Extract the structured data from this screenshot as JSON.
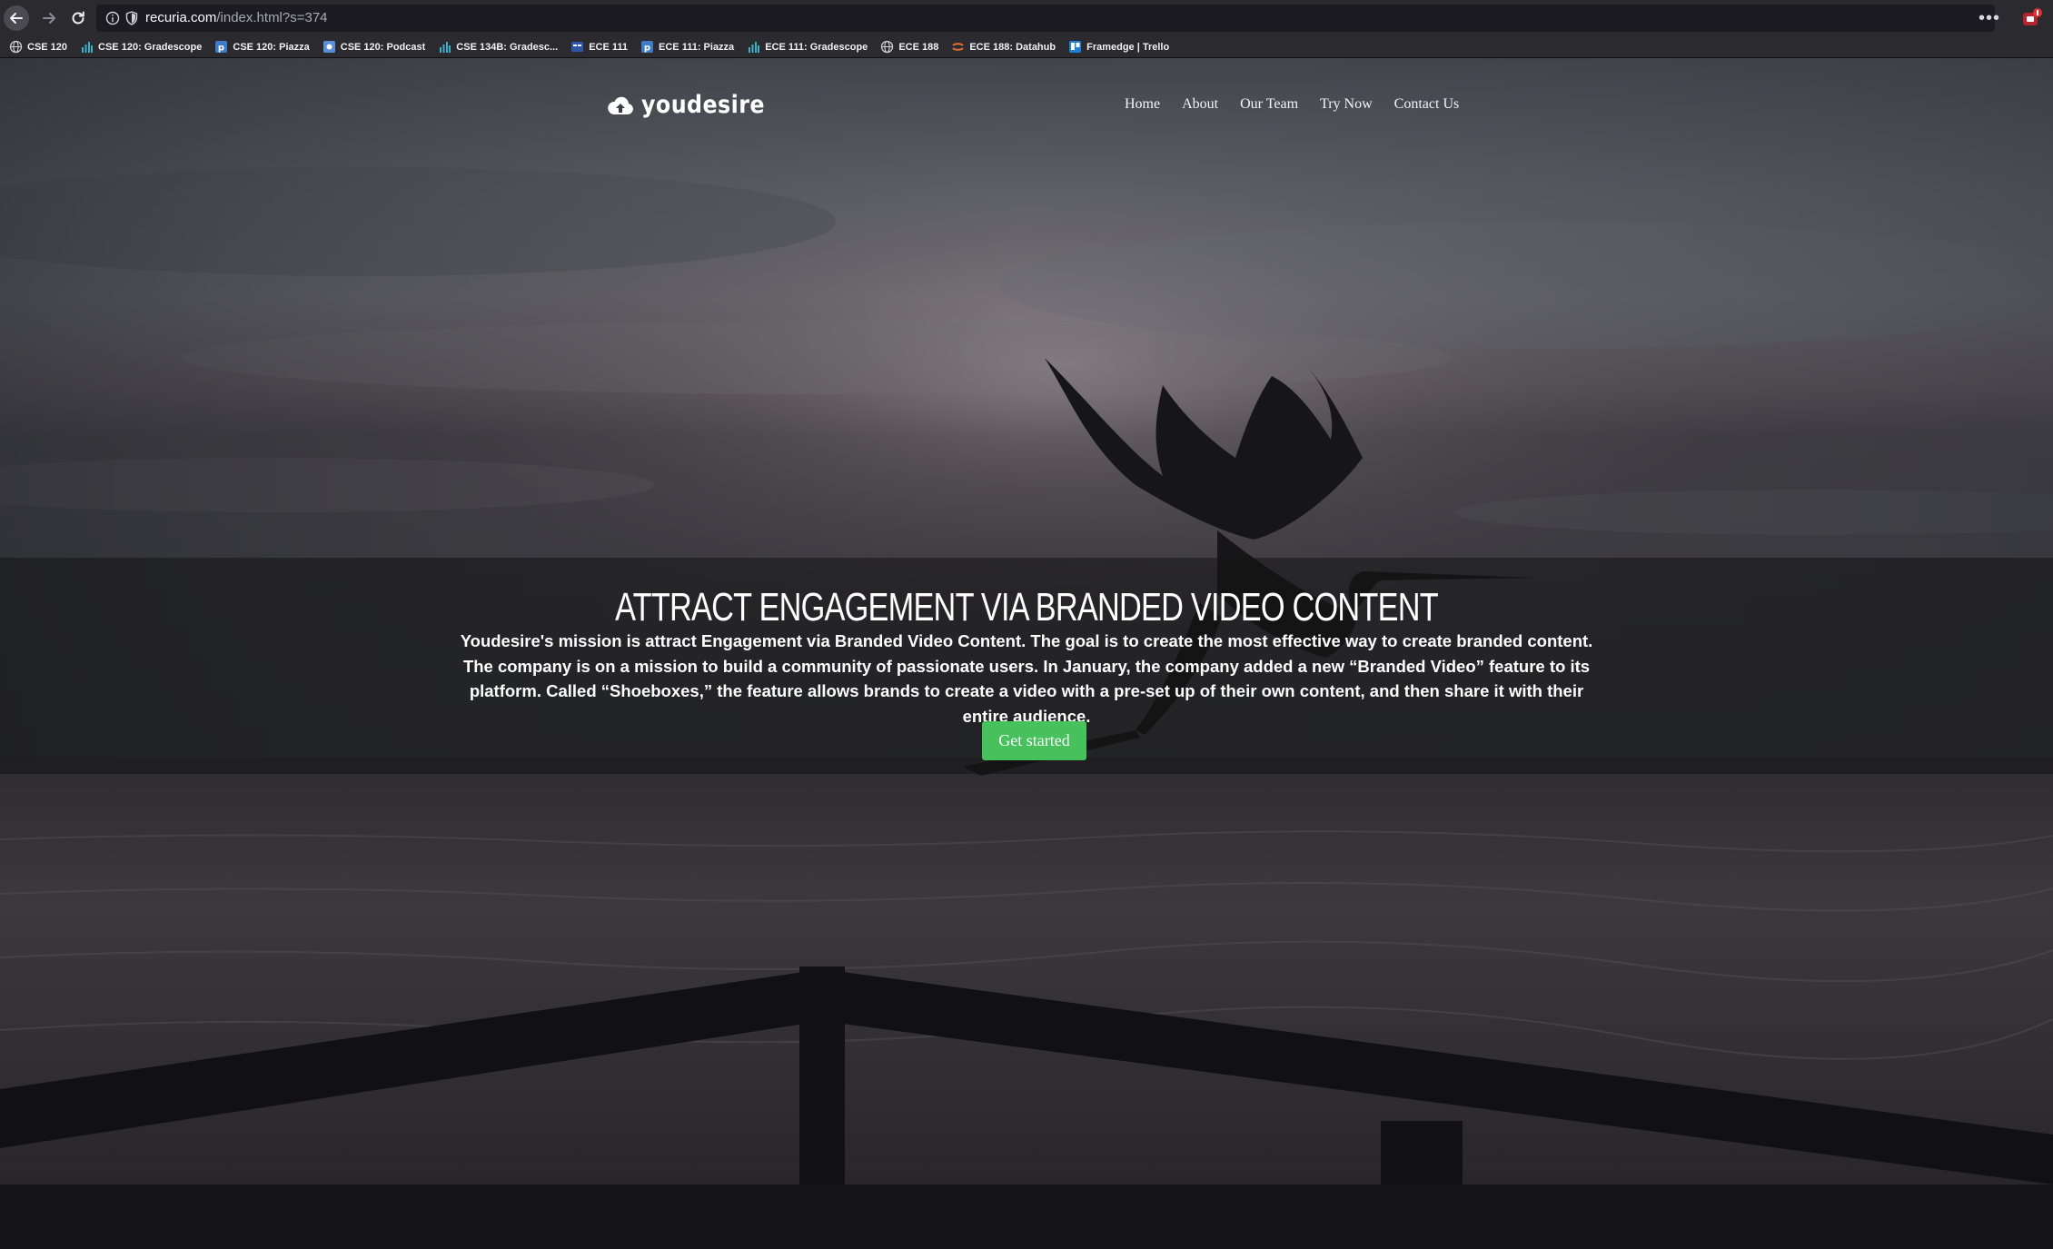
{
  "browser": {
    "url_host": "recuria.com",
    "url_path": "/index.html?s=374",
    "menu_glyph": "•••",
    "icons": {
      "back": "back-arrow-icon",
      "forward": "forward-arrow-icon",
      "reload": "reload-icon",
      "info": "info-icon",
      "shield": "shield-icon",
      "menu": "more-menu-icon",
      "extension": "extension-icon"
    },
    "bookmarks": [
      {
        "label": "CSE 120",
        "icon": "globe",
        "color": "#cfcfd4"
      },
      {
        "label": "CSE 120: Gradescope",
        "icon": "bars",
        "color": "#3bb0c9"
      },
      {
        "label": "CSE 120: Piazza",
        "icon": "piazza",
        "color": "#3e7cc7"
      },
      {
        "label": "CSE 120: Podcast",
        "icon": "podcast",
        "color": "#5a8fd8"
      },
      {
        "label": "CSE 134B: Gradesc...",
        "icon": "bars",
        "color": "#3bb0c9"
      },
      {
        "label": "ECE 111",
        "icon": "tile",
        "color": "#2f56a8"
      },
      {
        "label": "ECE 111: Piazza",
        "icon": "piazza",
        "color": "#3e7cc7"
      },
      {
        "label": "ECE 111: Gradescope",
        "icon": "bars",
        "color": "#3bb0c9"
      },
      {
        "label": "ECE 188",
        "icon": "globe",
        "color": "#cfcfd4"
      },
      {
        "label": "ECE 188: Datahub",
        "icon": "jupyter",
        "color": "#e46e2e"
      },
      {
        "label": "Framedge | Trello",
        "icon": "trello",
        "color": "#1e7fd6"
      }
    ]
  },
  "site": {
    "logo_text": "youdesire",
    "logo_icon": "cloud-upload-icon",
    "nav": [
      "Home",
      "About",
      "Our Team",
      "Try Now",
      "Contact Us"
    ],
    "hero": {
      "title": "ATTRACT ENGAGEMENT VIA BRANDED VIDEO CONTENT",
      "body": "Youdesire's mission is attract Engagement via Branded Video Content. The goal is to create the most effective way to create branded content. The company is on a mission to build a community of passionate users. In January, the company added a new “Branded Video” feature to its platform. Called “Shoeboxes,” the feature allows brands to create a video with a pre-set up of their own content, and then share it with their entire audience.",
      "cta_label": "Get started",
      "cta_color": "#47c15c"
    },
    "background": "heron-flying-over-sea-at-dusk"
  }
}
